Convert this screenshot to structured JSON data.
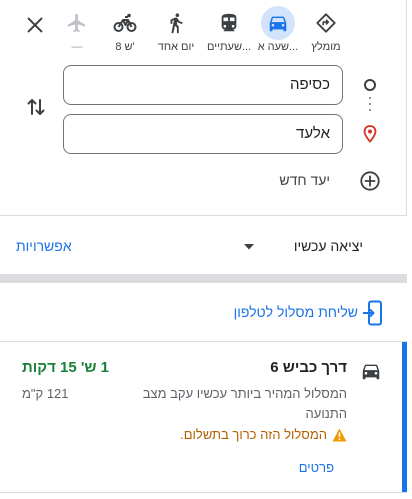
{
  "modes": [
    {
      "label": "מומלץ",
      "icon": "directions-diamond-icon"
    },
    {
      "label": "שעה א...",
      "icon": "car-icon",
      "active": true
    },
    {
      "label": "שעתיים...",
      "icon": "transit-icon"
    },
    {
      "label": "יום אחד",
      "icon": "walk-icon"
    },
    {
      "label": "8 ש'",
      "icon": "bike-icon"
    },
    {
      "label": "—",
      "icon": "flight-icon",
      "disabled": true
    }
  ],
  "route": {
    "origin": "כסיפה",
    "destination": "אלעד",
    "add_destination": "יעד חדש"
  },
  "depart": {
    "label": "יציאה עכשיו",
    "options": "אפשרויות"
  },
  "send_to_phone": "שליחת מסלול לטלפון",
  "result": {
    "title": "דרך כביש 6",
    "duration": "1 ש' 15 דקות",
    "desc_line1": "המסלול המהיר ביותר עכשיו עקב מצב",
    "desc_line2": "התנועה",
    "distance": "121 ק\"מ",
    "warning": "המסלול הזה כרוך בתשלום.",
    "details": "פרטים"
  },
  "colors": {
    "accent": "#1a73e8",
    "active_bg": "#d2e3fc",
    "duration_green": "#188038",
    "warning_orange": "#b06000",
    "warning_icon": "#f29900"
  }
}
